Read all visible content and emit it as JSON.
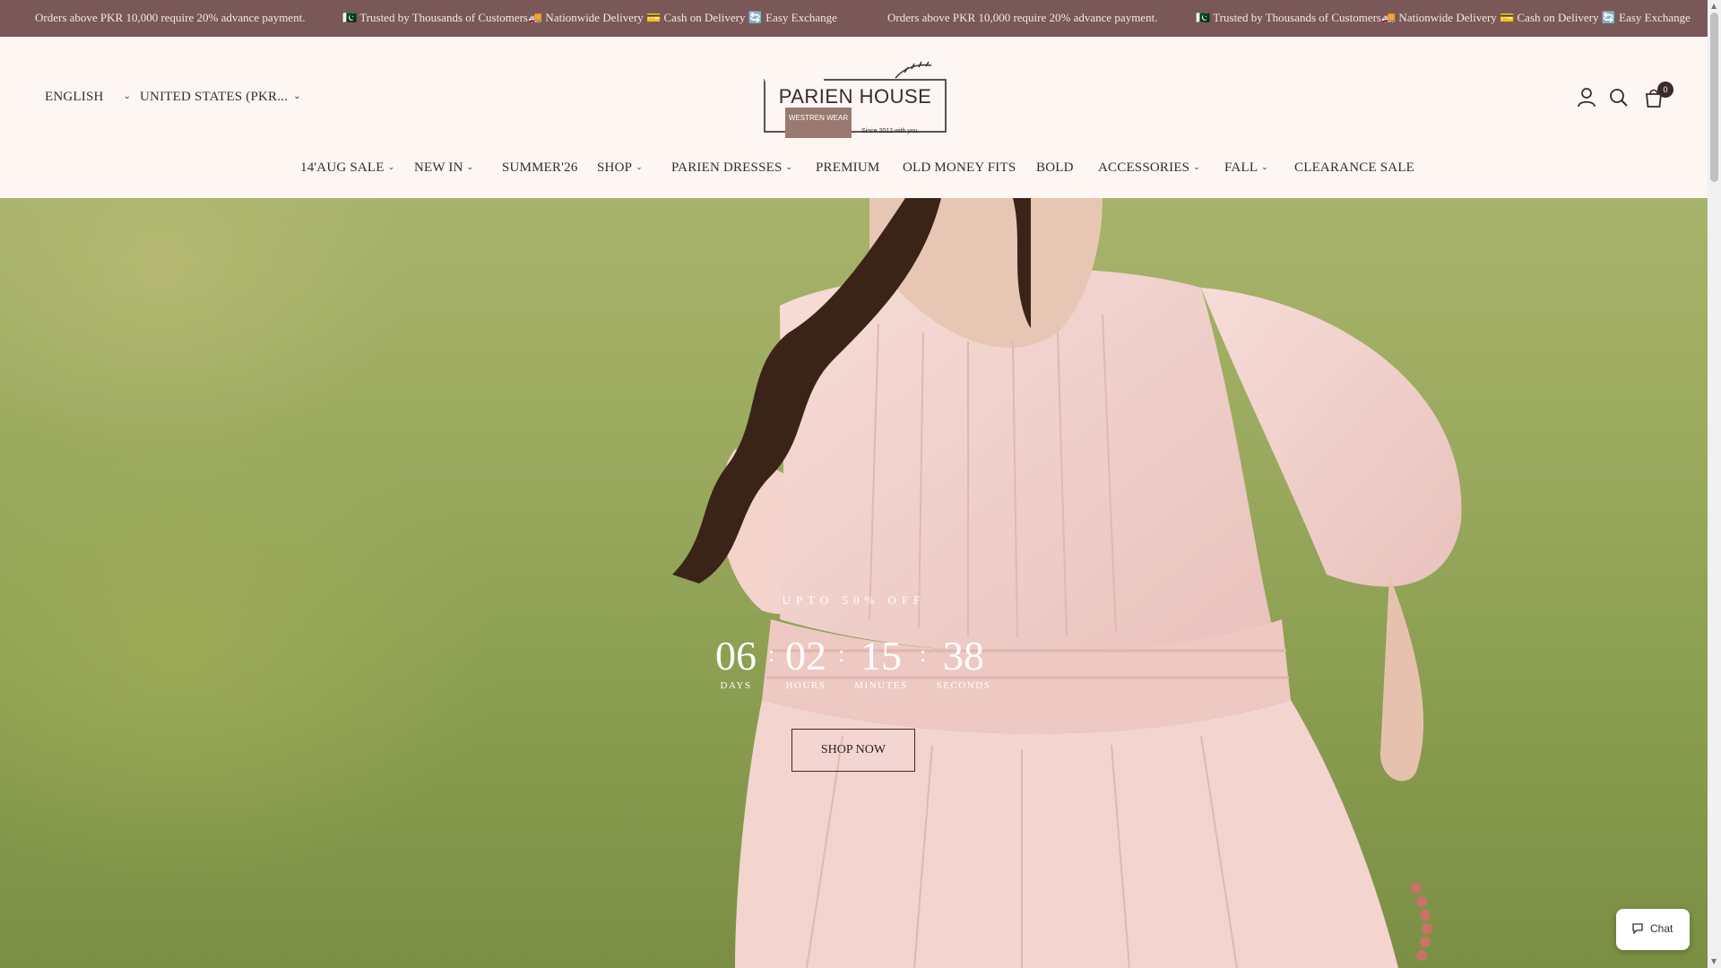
{
  "announcement": {
    "items": [
      "Orders above PKR 10,000 require 20% advance payment.",
      "🇵🇰 Trusted by Thousands of Customers🚚 Nationwide Delivery 💳 Cash on Delivery 🔄 Easy Exchange",
      "Orders above PKR 10,000 require 20% advance payment.",
      "🇵🇰 Trusted by Thousands of Customers🚚 Nationwide Delivery 💳 Cash on Delivery 🔄 Easy Exchange"
    ]
  },
  "header": {
    "language": "ENGLISH",
    "country": "UNITED STATES (PKR...",
    "logo": {
      "name": "PARIEN HOUSE",
      "tagline": "WESTREN WEAR",
      "since": "Since 2012 with you"
    },
    "icons": {
      "account": "user-icon",
      "search": "search-icon",
      "cart": "cart-icon"
    },
    "cart_count": "0"
  },
  "nav": {
    "items": [
      {
        "label": "14'AUG SALE",
        "has_dropdown": true
      },
      {
        "label": "NEW IN",
        "has_dropdown": true
      },
      {
        "label": "SUMMER'26",
        "has_dropdown": false
      },
      {
        "label": "SHOP",
        "has_dropdown": true
      },
      {
        "label": "PARIEN DRESSES",
        "has_dropdown": true
      },
      {
        "label": "PREMIUM",
        "has_dropdown": false
      },
      {
        "label": "OLD MONEY FITS",
        "has_dropdown": false
      },
      {
        "label": "BOLD",
        "has_dropdown": false
      },
      {
        "label": "ACCESSORIES",
        "has_dropdown": true
      },
      {
        "label": "FALL",
        "has_dropdown": true
      },
      {
        "label": "CLEARANCE SALE",
        "has_dropdown": false
      }
    ]
  },
  "hero": {
    "promo": "UPTO 50% OFF",
    "countdown": [
      {
        "value": "06",
        "label": "DAYS"
      },
      {
        "value": "02",
        "label": "HOURS"
      },
      {
        "value": "15",
        "label": "MINUTES"
      },
      {
        "value": "38",
        "label": "SECONDS"
      }
    ],
    "separator": ":",
    "cta": "SHOP NOW"
  },
  "chat": {
    "label": "Chat",
    "icon": "chat-bubble-icon"
  },
  "colors": {
    "announcement_bg": "#7a5858",
    "header_bg": "#fdf6f3",
    "text": "#3a2a2a",
    "dress": "#f1cfcb"
  }
}
